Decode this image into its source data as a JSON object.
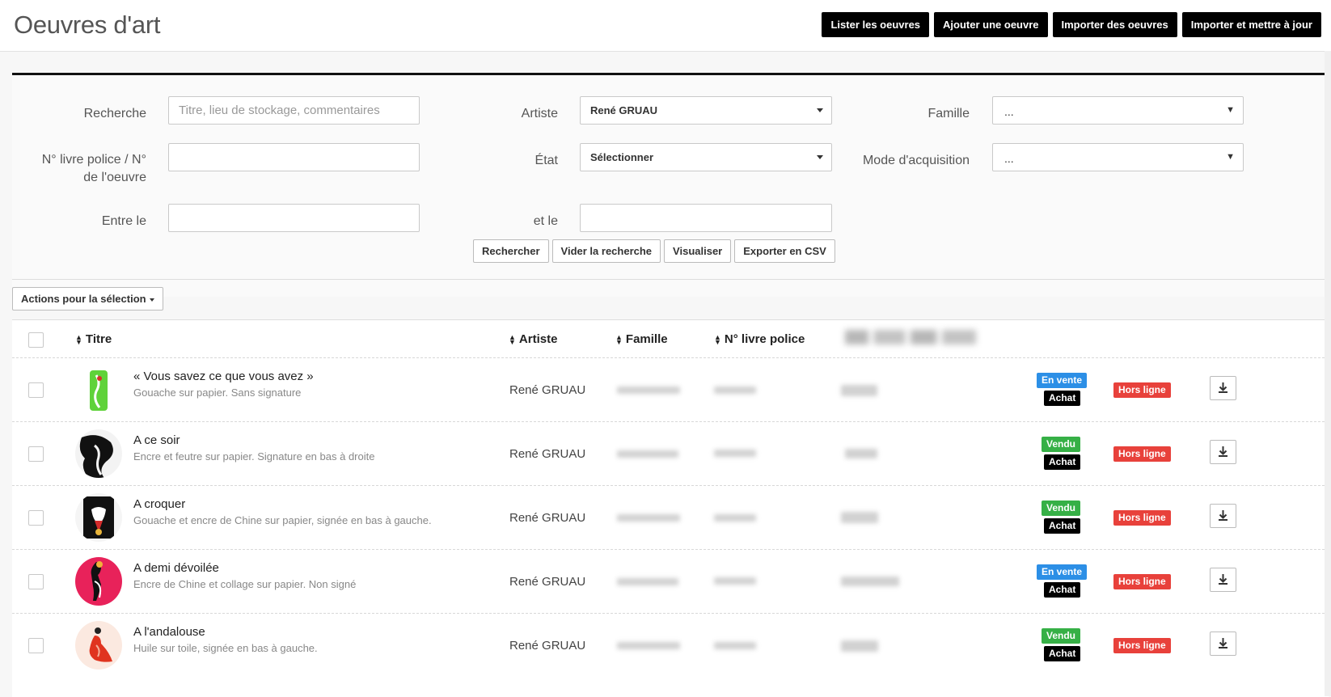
{
  "header": {
    "title": "Oeuvres d'art",
    "nav": [
      {
        "label": "Lister les oeuvres"
      },
      {
        "label": "Ajouter une oeuvre"
      },
      {
        "label": "Importer des oeuvres"
      },
      {
        "label": "Importer et mettre à jour"
      }
    ]
  },
  "search": {
    "recherche_label": "Recherche",
    "recherche_placeholder": "Titre, lieu de stockage, commentaires",
    "artiste_label": "Artiste",
    "artiste_value": "René GRUAU",
    "famille_label": "Famille",
    "famille_value": "...",
    "numero_label_line1": "N° livre police / N°",
    "numero_label_line2": "de l'oeuvre",
    "etat_label": "État",
    "etat_value": "Sélectionner",
    "mode_label": "Mode d'acquisition",
    "mode_value": "...",
    "entre_label": "Entre le",
    "etle_label": "et le",
    "buttons": {
      "rechercher": "Rechercher",
      "vider": "Vider la recherche",
      "visualiser": "Visualiser",
      "exporter": "Exporter en CSV"
    }
  },
  "selection_actions_label": "Actions pour la sélection",
  "table": {
    "columns": {
      "titre": "Titre",
      "artiste": "Artiste",
      "famille": "Famille",
      "police": "N° livre police"
    },
    "rows": [
      {
        "title": "« Vous savez ce que vous avez »",
        "subtitle": "Gouache sur papier. Sans signature",
        "artist": "René GRUAU",
        "status": "En vente",
        "status_color": "#2c8fe6",
        "acquisition": "Achat",
        "visibility": "Hors ligne",
        "thumb_bg": "#ffffff",
        "thumb_fg": "#5fd23a"
      },
      {
        "title": "A ce soir",
        "subtitle": "Encre et feutre sur papier. Signature en bas à droite",
        "artist": "René GRUAU",
        "status": "Vendu",
        "status_color": "#36b046",
        "acquisition": "Achat",
        "visibility": "Hors ligne",
        "thumb_bg": "#f3f3f3",
        "thumb_fg": "#111111"
      },
      {
        "title": "A croquer",
        "subtitle": "Gouache et encre de Chine sur papier, signée en bas à gauche.",
        "artist": "René GRUAU",
        "status": "Vendu",
        "status_color": "#36b046",
        "acquisition": "Achat",
        "visibility": "Hors ligne",
        "thumb_bg": "#111111",
        "thumb_fg": "#d42b2b"
      },
      {
        "title": "A demi dévoilée",
        "subtitle": "Encre de Chine et collage sur papier. Non signé",
        "artist": "René GRUAU",
        "status": "En vente",
        "status_color": "#2c8fe6",
        "acquisition": "Achat",
        "visibility": "Hors ligne",
        "thumb_bg": "#e8225a",
        "thumb_fg": "#111111"
      },
      {
        "title": "A l'andalouse",
        "subtitle": "Huile sur toile, signée en bas à gauche.",
        "artist": "René GRUAU",
        "status": "Vendu",
        "status_color": "#36b046",
        "acquisition": "Achat",
        "visibility": "Hors ligne",
        "thumb_bg": "#fbe9e0",
        "thumb_fg": "#e0341f"
      }
    ]
  }
}
